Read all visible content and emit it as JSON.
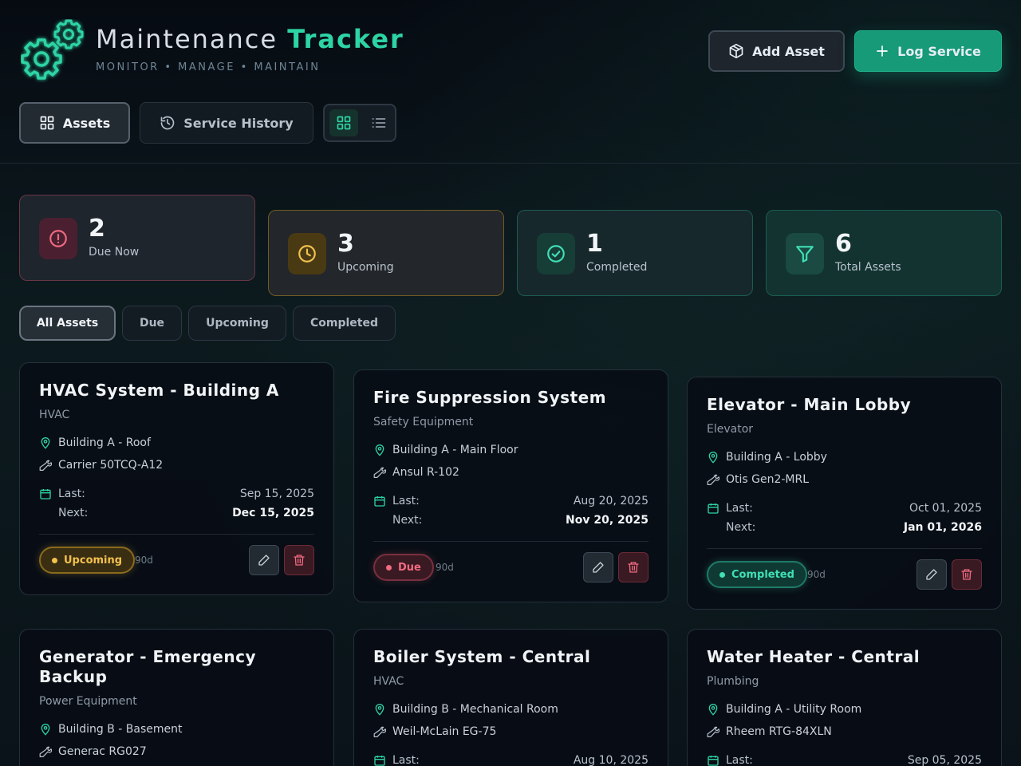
{
  "app": {
    "title_main": "Maintenance",
    "title_accent": "Tracker",
    "subtitle": "MONITOR • MANAGE • MAINTAIN",
    "accent_color": "#2dd4a4"
  },
  "header": {
    "add_asset_label": "Add Asset",
    "log_service_label": "Log Service"
  },
  "tabs": [
    {
      "label": "Assets",
      "icon": "grid-icon",
      "active": true
    },
    {
      "label": "Service History",
      "icon": "history-icon",
      "active": false
    }
  ],
  "view_toggle": {
    "active": "grid"
  },
  "stats": [
    {
      "value": "2",
      "label": "Due Now",
      "icon": "alert-circle-icon",
      "color": "#f06a82"
    },
    {
      "value": "3",
      "label": "Upcoming",
      "icon": "clock-icon",
      "color": "#f2c14e"
    },
    {
      "value": "1",
      "label": "Completed",
      "icon": "check-circle-icon",
      "color": "#3fe0b5"
    },
    {
      "value": "6",
      "label": "Total Assets",
      "icon": "filter-icon",
      "color": "#3fe0b5"
    }
  ],
  "filters": [
    {
      "label": "All Assets",
      "active": true
    },
    {
      "label": "Due",
      "active": false
    },
    {
      "label": "Upcoming",
      "active": false
    },
    {
      "label": "Completed",
      "active": false
    }
  ],
  "date_labels": {
    "last": "Last:",
    "next": "Next:"
  },
  "assets": [
    {
      "name": "HVAC System - Building A",
      "category": "HVAC",
      "location": "Building A - Roof",
      "model": "Carrier 50TCQ-A12",
      "last": "Sep 15, 2025",
      "next": "Dec 15, 2025",
      "status": "Upcoming",
      "interval": "90d"
    },
    {
      "name": "Fire Suppression System",
      "category": "Safety Equipment",
      "location": "Building A - Main Floor",
      "model": "Ansul R-102",
      "last": "Aug 20, 2025",
      "next": "Nov 20, 2025",
      "status": "Due",
      "interval": "90d"
    },
    {
      "name": "Elevator - Main Lobby",
      "category": "Elevator",
      "location": "Building A - Lobby",
      "model": "Otis Gen2-MRL",
      "last": "Oct 01, 2025",
      "next": "Jan 01, 2026",
      "status": "Completed",
      "interval": "90d"
    },
    {
      "name": "Generator - Emergency Backup",
      "category": "Power Equipment",
      "location": "Building B - Basement",
      "model": "Generac RG027"
    },
    {
      "name": "Boiler System - Central",
      "category": "HVAC",
      "location": "Building B - Mechanical Room",
      "model": "Weil-McLain EG-75",
      "last": "Aug 10, 2025"
    },
    {
      "name": "Water Heater - Central",
      "category": "Plumbing",
      "location": "Building A - Utility Room",
      "model": "Rheem RTG-84XLN",
      "last": "Sep 05, 2025"
    }
  ]
}
